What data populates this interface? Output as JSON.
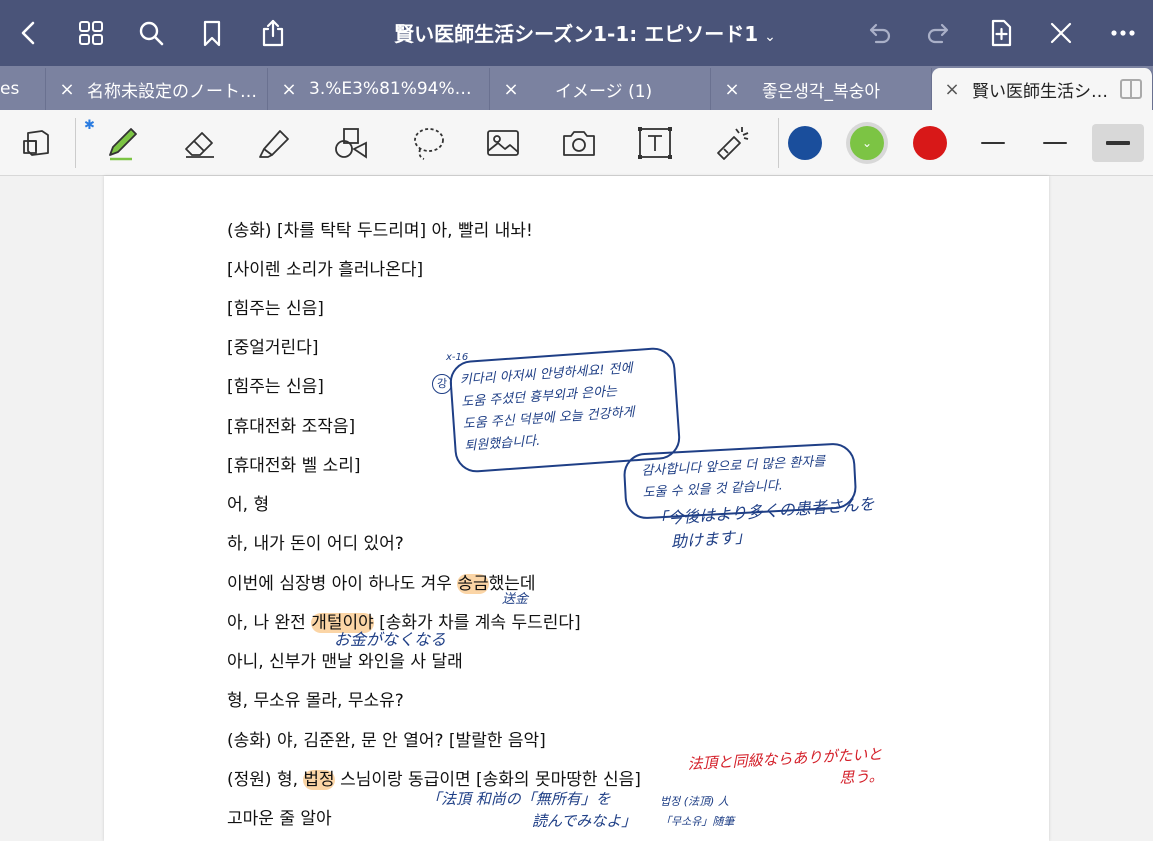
{
  "header": {
    "title": "賢い医師生活シーズン1-1: エピソード1",
    "chevron": "⌄"
  },
  "tabs": [
    {
      "label": "es",
      "close": ""
    },
    {
      "label": "名称未設定のノート…",
      "close": "×"
    },
    {
      "label": "3.%E3%81%94%E…",
      "close": "×"
    },
    {
      "label": "イメージ (1)",
      "close": "×"
    },
    {
      "label": "좋은생각_복숭아",
      "close": "×"
    },
    {
      "label": "賢い医師生活シ…",
      "close": "×"
    }
  ],
  "toolbar": {
    "bluetooth": "✱",
    "colors": [
      "#1a4e9c",
      "#7cc444",
      "#d81818"
    ]
  },
  "document": {
    "lines": [
      "(송화) [차를 탁탁 두드리며] 아, 빨리 내놔!",
      "[사이렌 소리가 흘러나온다]",
      "[힘주는 신음]",
      "[중얼거린다]",
      "[힘주는 신음]",
      "[휴대전화 조작음]",
      "[휴대전화 벨 소리]",
      "어, 형",
      "하, 내가 돈이 어디 있어?"
    ],
    "l10": {
      "pre": "이번에 심장병 아이 하나도 겨우 ",
      "hl": "송금",
      "post": "했는데"
    },
    "l11": {
      "pre": "아, 나 완전 ",
      "hl": "개털이야",
      "post": " [송화가 차를 계속 두드린다]"
    },
    "l12": "아니, 신부가 맨날 와인을 사 달래",
    "l13": "형, 무소유 몰라, 무소유?",
    "l14": "(송화) 야, 김준완, 문 안 열어? [발랄한 음악]",
    "l15": {
      "pre": "(정원) 형, ",
      "hl": "법정",
      "post": " 스님이랑 동급이면 [송화의 못마땅한 신음]"
    },
    "l16": "고마운 줄 알아"
  },
  "annotations": {
    "x16": "x-16",
    "kang": "강",
    "bubble1": [
      "키다리 아저씨 안녕하세요! 전에",
      "도움 주셨던 흉부외과 은아는",
      "도움 주신 덕분에 오늘 건강하게",
      "퇴원했습니다."
    ],
    "bubble2": [
      "감사합니다 앞으로 더 많은 환자를",
      "도울 수 있을 것 같습니다."
    ],
    "jp_reply": [
      "「今後はより多くの患者さんを",
      "助けます」"
    ],
    "songkin": "送金",
    "okane": "お金がなくなる",
    "red_note": [
      "法頂と同級ならありがたいと",
      "思う。"
    ],
    "hoppo1": [
      "「法頂 和尚の「無所有」を",
      "読んでみなよ」"
    ],
    "hoppo2": [
      "법정 (法頂) 人",
      "「무소유」随筆"
    ]
  }
}
